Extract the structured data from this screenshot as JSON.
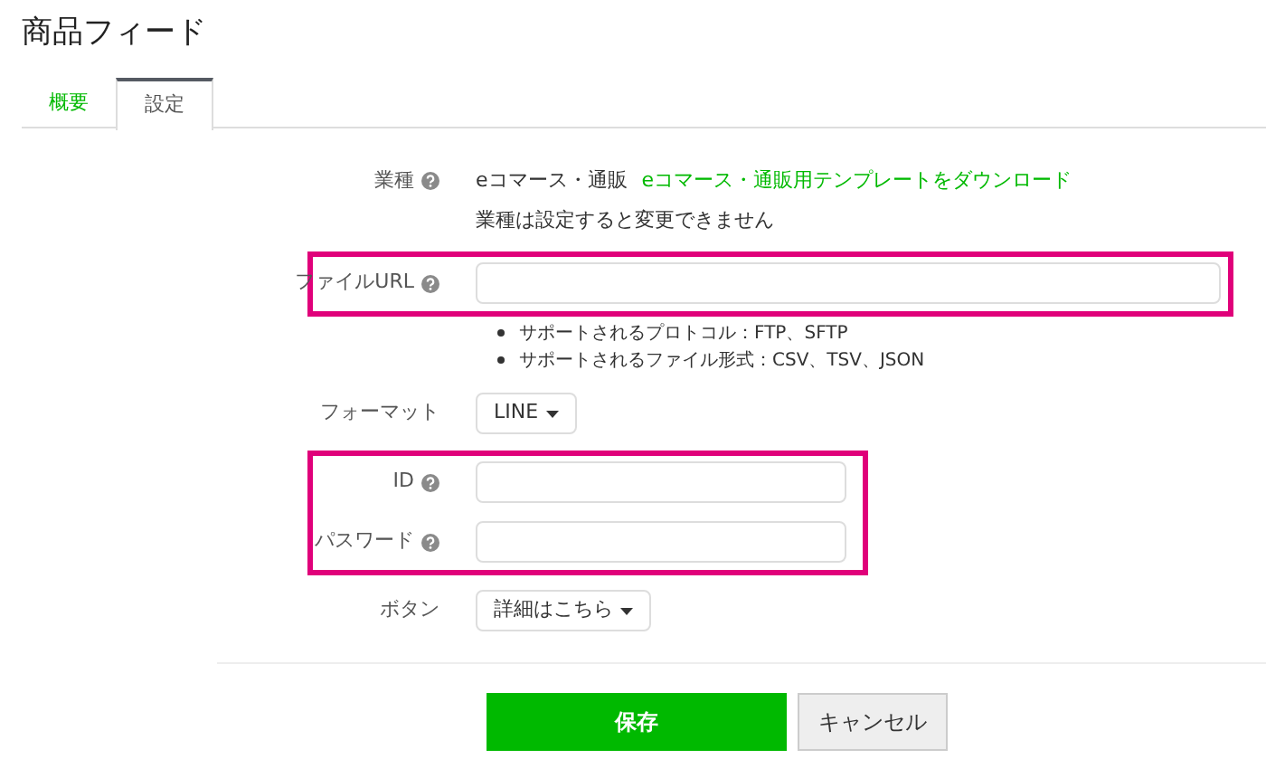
{
  "page_title": "商品フィード",
  "tabs": [
    {
      "label": "概要",
      "selected": false
    },
    {
      "label": "設定",
      "selected": true
    }
  ],
  "sections": [
    {
      "highlighted": false,
      "rows": [
        {
          "kind": "info",
          "label": "業種",
          "help": true,
          "value": "eコマース・通販",
          "link": "eコマース・通販用テンプレートをダウンロード",
          "note": "業種は設定すると変更できません"
        }
      ]
    },
    {
      "highlighted": true,
      "rows": [
        {
          "kind": "text",
          "label": "ファイルURL",
          "help": true,
          "wide": true,
          "hints": [
            "サポートされるプロトコル：FTP、SFTP",
            "サポートされるファイル形式：CSV、TSV、JSON"
          ]
        }
      ]
    },
    {
      "highlighted": false,
      "rows": [
        {
          "kind": "dropdown",
          "label": "フォーマット",
          "help": false,
          "value": "LINE"
        }
      ]
    },
    {
      "highlighted": true,
      "rows": [
        {
          "kind": "text",
          "label": "ID",
          "help": true,
          "wide": false
        },
        {
          "kind": "text",
          "label": "パスワード",
          "help": true,
          "wide": false
        }
      ]
    },
    {
      "highlighted": false,
      "rows": [
        {
          "kind": "dropdown",
          "label": "ボタン",
          "help": false,
          "value": "詳細はこちら"
        }
      ]
    }
  ],
  "buttons": [
    {
      "kind": "primary",
      "label": "保存"
    },
    {
      "kind": "secondary",
      "label": "キャンセル"
    }
  ]
}
